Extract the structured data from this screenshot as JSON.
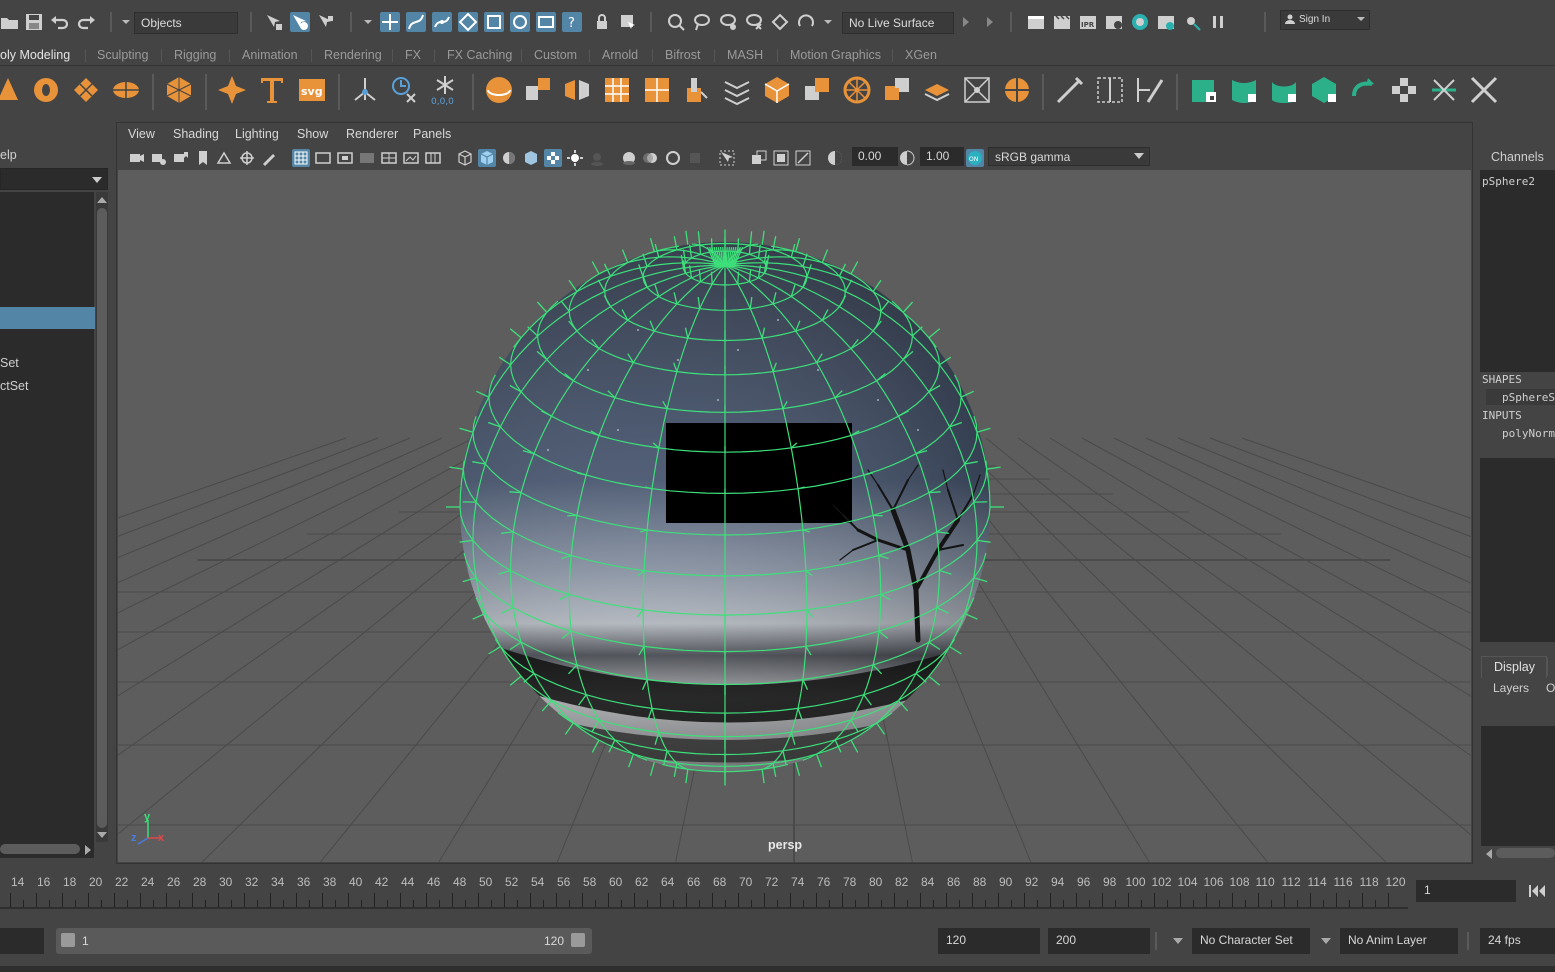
{
  "statusline": {
    "mode_dropdown": "Objects",
    "live_surface": "No Live Surface",
    "sign_in": "Sign In"
  },
  "shelf_tabs": [
    "oly Modeling",
    "Sculpting",
    "Rigging",
    "Animation",
    "Rendering",
    "FX",
    "FX Caching",
    "Custom",
    "Arnold",
    "Bifrost",
    "MASH",
    "Motion Graphics",
    "XGen"
  ],
  "left_panel": {
    "menu_partial": "elp",
    "items": [
      "Set",
      "ctSet"
    ]
  },
  "panel_menu": [
    "View",
    "Shading",
    "Lighting",
    "Show",
    "Renderer",
    "Panels"
  ],
  "panel_toolbar": {
    "exposure": "0.00",
    "gamma": "1.00",
    "color_space": "sRGB gamma"
  },
  "viewport": {
    "camera_label": "persp",
    "axis_y": "y",
    "axis_z": "z",
    "axis_x": "x"
  },
  "right_panel": {
    "channels_label": "Channels",
    "object_name": "pSphere2",
    "shapes_header": "SHAPES",
    "shape_item": "pSphereS",
    "inputs_header": "INPUTS",
    "input_item": "polyNorm",
    "display_tab": "Display",
    "layers_menu": "Layers",
    "layers_menu_partial": "O"
  },
  "time_slider": {
    "labels": [
      "14",
      "16",
      "18",
      "20",
      "22",
      "24",
      "26",
      "28",
      "30",
      "32",
      "34",
      "36",
      "38",
      "40",
      "42",
      "44",
      "46",
      "48",
      "50",
      "52",
      "54",
      "56",
      "58",
      "60",
      "62",
      "64",
      "66",
      "68",
      "70",
      "72",
      "74",
      "76",
      "78",
      "80",
      "82",
      "84",
      "86",
      "88",
      "90",
      "92",
      "94",
      "96",
      "98",
      "100",
      "102",
      "104",
      "106",
      "108",
      "110",
      "112",
      "114",
      "116",
      "118",
      "120"
    ],
    "current_frame": "1"
  },
  "range_slider": {
    "range_start": "1",
    "range_end": "120",
    "anim_end": "120",
    "anim_total": "200",
    "character_set": "No Character Set",
    "anim_layer": "No Anim Layer",
    "fps": "24 fps"
  },
  "colors": {
    "accent": "#5285a6",
    "shelf_orange": "#e8923a",
    "shelf_teal": "#2bb08a",
    "wire_green": "#3de07a"
  }
}
